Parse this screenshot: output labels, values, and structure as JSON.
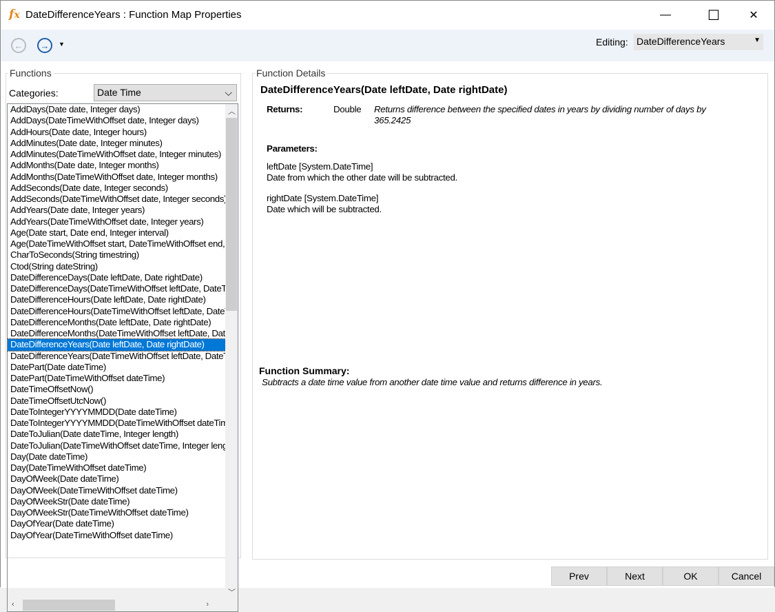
{
  "window": {
    "title": "DateDifferenceYears : Function Map Properties",
    "app_icon": "fx-icon",
    "minimize": "—",
    "maximize": "☐",
    "close": "✕"
  },
  "toolbar": {
    "back_icon": "back-arrow-icon",
    "forward_icon": "forward-arrow-icon",
    "editing_label": "Editing:",
    "editing_value": "DateDifferenceYears"
  },
  "functions": {
    "group_label": "Functions",
    "categories_label": "Categories:",
    "category_value": "Date Time",
    "items": [
      "AddDays(Date date, Integer days)",
      "AddDays(DateTimeWithOffset date, Integer days)",
      "AddHours(Date date, Integer hours)",
      "AddMinutes(Date date, Integer minutes)",
      "AddMinutes(DateTimeWithOffset date, Integer minutes)",
      "AddMonths(Date date, Integer months)",
      "AddMonths(DateTimeWithOffset date, Integer months)",
      "AddSeconds(Date date, Integer seconds)",
      "AddSeconds(DateTimeWithOffset date, Integer seconds)",
      "AddYears(Date date, Integer years)",
      "AddYears(DateTimeWithOffset date, Integer years)",
      "Age(Date start, Date end, Integer interval)",
      "Age(DateTimeWithOffset start, DateTimeWithOffset end, Integer interval)",
      "CharToSeconds(String timestring)",
      "Ctod(String dateString)",
      "DateDifferenceDays(Date leftDate, Date rightDate)",
      "DateDifferenceDays(DateTimeWithOffset leftDate, DateTimeWithOffset rightDate)",
      "DateDifferenceHours(Date leftDate, Date rightDate)",
      "DateDifferenceHours(DateTimeWithOffset leftDate, DateTimeWithOffset rightDate)",
      "DateDifferenceMonths(Date leftDate, Date rightDate)",
      "DateDifferenceMonths(DateTimeWithOffset leftDate, DateTimeWithOffset rightDate)",
      "DateDifferenceYears(Date leftDate, Date rightDate)",
      "DateDifferenceYears(DateTimeWithOffset leftDate, DateTimeWithOffset rightDate)",
      "DatePart(Date dateTime)",
      "DatePart(DateTimeWithOffset dateTime)",
      "DateTimeOffsetNow()",
      "DateTimeOffsetUtcNow()",
      "DateToIntegerYYYYMMDD(Date dateTime)",
      "DateToIntegerYYYYMMDD(DateTimeWithOffset dateTime)",
      "DateToJulian(Date dateTime, Integer length)",
      "DateToJulian(DateTimeWithOffset dateTime, Integer length)",
      "Day(Date dateTime)",
      "Day(DateTimeWithOffset dateTime)",
      "DayOfWeek(Date dateTime)",
      "DayOfWeek(DateTimeWithOffset dateTime)",
      "DayOfWeekStr(Date dateTime)",
      "DayOfWeekStr(DateTimeWithOffset dateTime)",
      "DayOfYear(Date dateTime)",
      "DayOfYear(DateTimeWithOffset dateTime)"
    ],
    "selected_index": 21
  },
  "details": {
    "group_label": "Function Details",
    "signature": "DateDifferenceYears(Date leftDate, Date rightDate)",
    "returns_label": "Returns:",
    "returns_type": "Double",
    "returns_desc": "Returns difference between the specified dates in years by dividing number of days by 365.2425",
    "parameters_label": "Parameters:",
    "parameters": [
      {
        "name": "leftDate [System.DateTime]",
        "desc": "Date from which the other date will be subtracted."
      },
      {
        "name": "rightDate [System.DateTime]",
        "desc": "Date which will be subtracted."
      }
    ],
    "summary_label": "Function Summary:",
    "summary": "Subtracts a date time value from another date time value and returns difference in years."
  },
  "buttons": {
    "prev": "Prev",
    "next": "Next",
    "ok": "OK",
    "cancel": "Cancel"
  },
  "colors": {
    "selection": "#0078d7",
    "toolbar_bg": "#eef3f9",
    "fx_icon": "#e08a1e"
  }
}
